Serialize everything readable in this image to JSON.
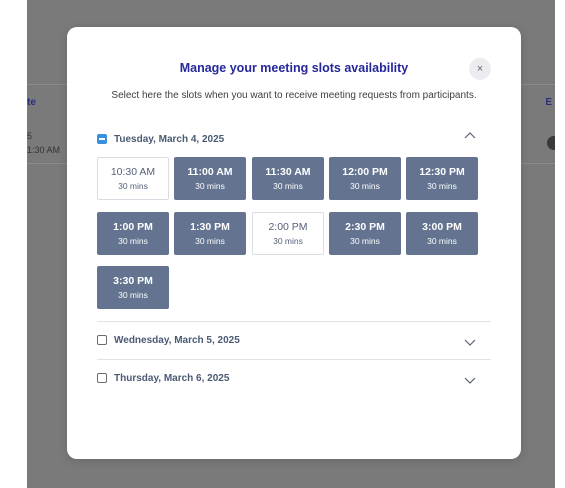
{
  "background": {
    "column_fragment": "te",
    "column_fragment_right": "E",
    "cell_line_1": "5",
    "cell_line_2": "1:30 AM"
  },
  "modal": {
    "title": "Manage your meeting slots availability",
    "close_icon": "×",
    "subtitle": "Select here the slots when you want to receive meeting requests from participants."
  },
  "days": [
    {
      "label": "Tuesday, March 4, 2025",
      "state": "partial",
      "expanded": true,
      "slots": [
        {
          "time": "10:30 AM",
          "duration": "30 mins",
          "selected": false
        },
        {
          "time": "11:00 AM",
          "duration": "30 mins",
          "selected": true
        },
        {
          "time": "11:30 AM",
          "duration": "30 mins",
          "selected": true
        },
        {
          "time": "12:00 PM",
          "duration": "30 mins",
          "selected": true
        },
        {
          "time": "12:30 PM",
          "duration": "30 mins",
          "selected": true
        },
        {
          "time": "1:00 PM",
          "duration": "30 mins",
          "selected": true
        },
        {
          "time": "1:30 PM",
          "duration": "30 mins",
          "selected": true
        },
        {
          "time": "2:00 PM",
          "duration": "30 mins",
          "selected": false
        },
        {
          "time": "2:30 PM",
          "duration": "30 mins",
          "selected": true
        },
        {
          "time": "3:00 PM",
          "duration": "30 mins",
          "selected": true
        },
        {
          "time": "3:30 PM",
          "duration": "30 mins",
          "selected": true
        }
      ]
    },
    {
      "label": "Wednesday, March 5, 2025",
      "state": "unchecked",
      "expanded": false
    },
    {
      "label": "Thursday, March 6, 2025",
      "state": "unchecked",
      "expanded": false
    }
  ]
}
